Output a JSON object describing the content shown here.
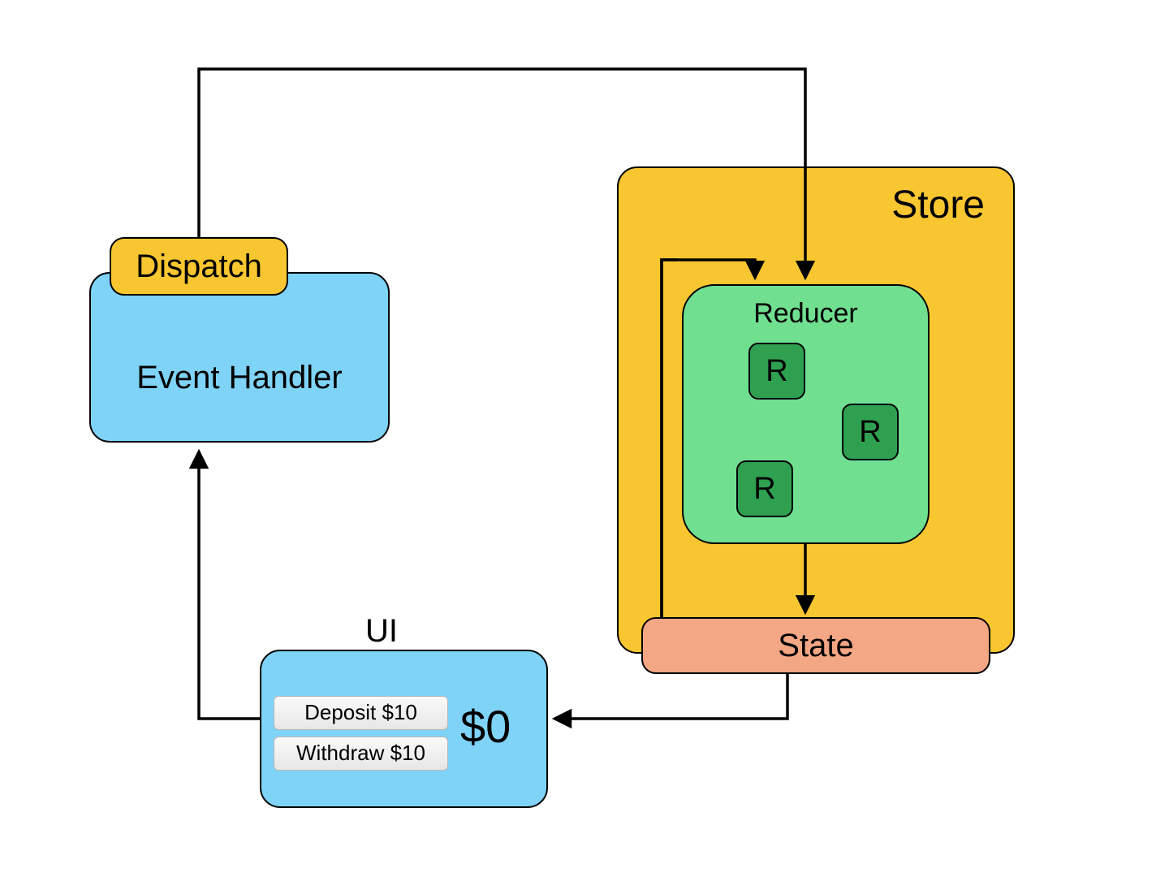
{
  "dispatch": {
    "label": "Dispatch"
  },
  "event_handler": {
    "label": "Event Handler"
  },
  "store": {
    "label": "Store"
  },
  "reducer": {
    "label": "Reducer",
    "chips": [
      "R",
      "R",
      "R"
    ]
  },
  "state": {
    "label": "State"
  },
  "ui": {
    "title": "UI",
    "deposit_label": "Deposit $10",
    "withdraw_label": "Withdraw $10",
    "balance": "$0"
  }
}
